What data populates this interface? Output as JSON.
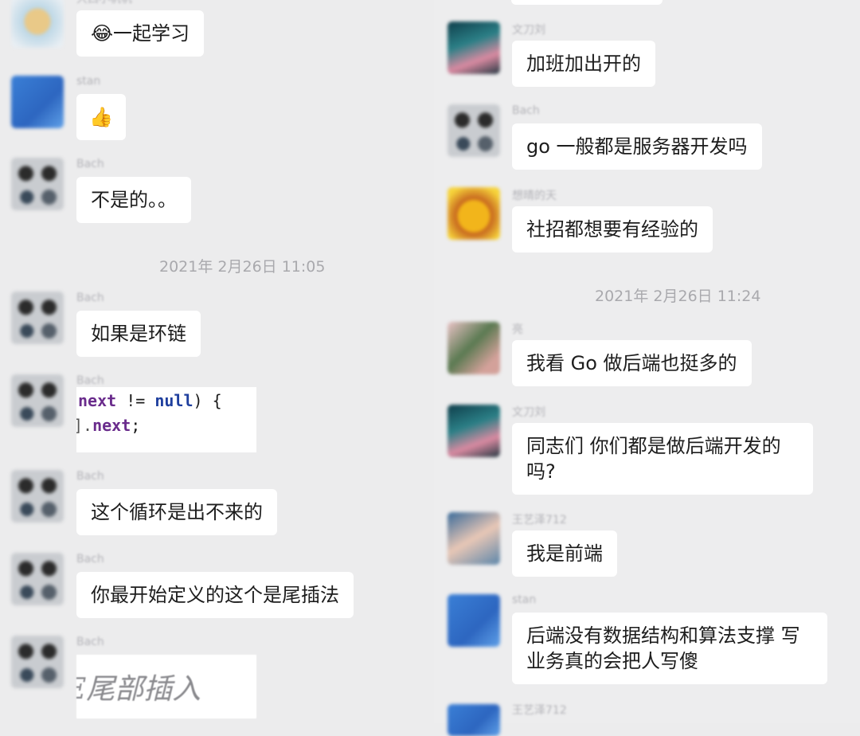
{
  "left": {
    "messages": [
      {
        "sender": "大西小帆帆",
        "text": "😂一起学习"
      },
      {
        "sender": "stan",
        "text": "👍"
      },
      {
        "sender": "Bach",
        "text": "不是的。。"
      },
      {
        "sender": "Bach",
        "text": "如果是环链"
      },
      {
        "sender": "Bach",
        "code": {
          "line1_kw": "next",
          "line1_op": " != ",
          "line1_null": "null",
          "line1_tail": ") {",
          "line2_prefix": "].",
          "line2_kw": "next",
          "line2_tail": ";"
        }
      },
      {
        "sender": "Bach",
        "text": "这个循环是出不来的"
      },
      {
        "sender": "Bach",
        "text": "你最开始定义的这个是尾插法"
      },
      {
        "sender": "Bach",
        "image_text": "E尾部插入"
      }
    ],
    "timestamp": "2021年 2月26日 11:05"
  },
  "right": {
    "messages": [
      {
        "sender": "文刀刘",
        "text": "加班加出开的"
      },
      {
        "sender": "Bach",
        "text": "go 一般都是服务器开发吗"
      },
      {
        "sender": "想晴的天",
        "text": "社招都想要有经验的"
      },
      {
        "sender": "亮",
        "text": "我看 Go 做后端也挺多的"
      },
      {
        "sender": "文刀刘",
        "text": "同志们  你们都是做后端开发的吗?"
      },
      {
        "sender": "王艺泽712",
        "text": "我是前端"
      },
      {
        "sender": "stan",
        "text": "后端没有数据结构和算法支撑 写业务真的会把人写傻"
      },
      {
        "sender": "王艺泽712",
        "text": ""
      }
    ],
    "timestamp": "2021年 2月26日 11:24"
  }
}
